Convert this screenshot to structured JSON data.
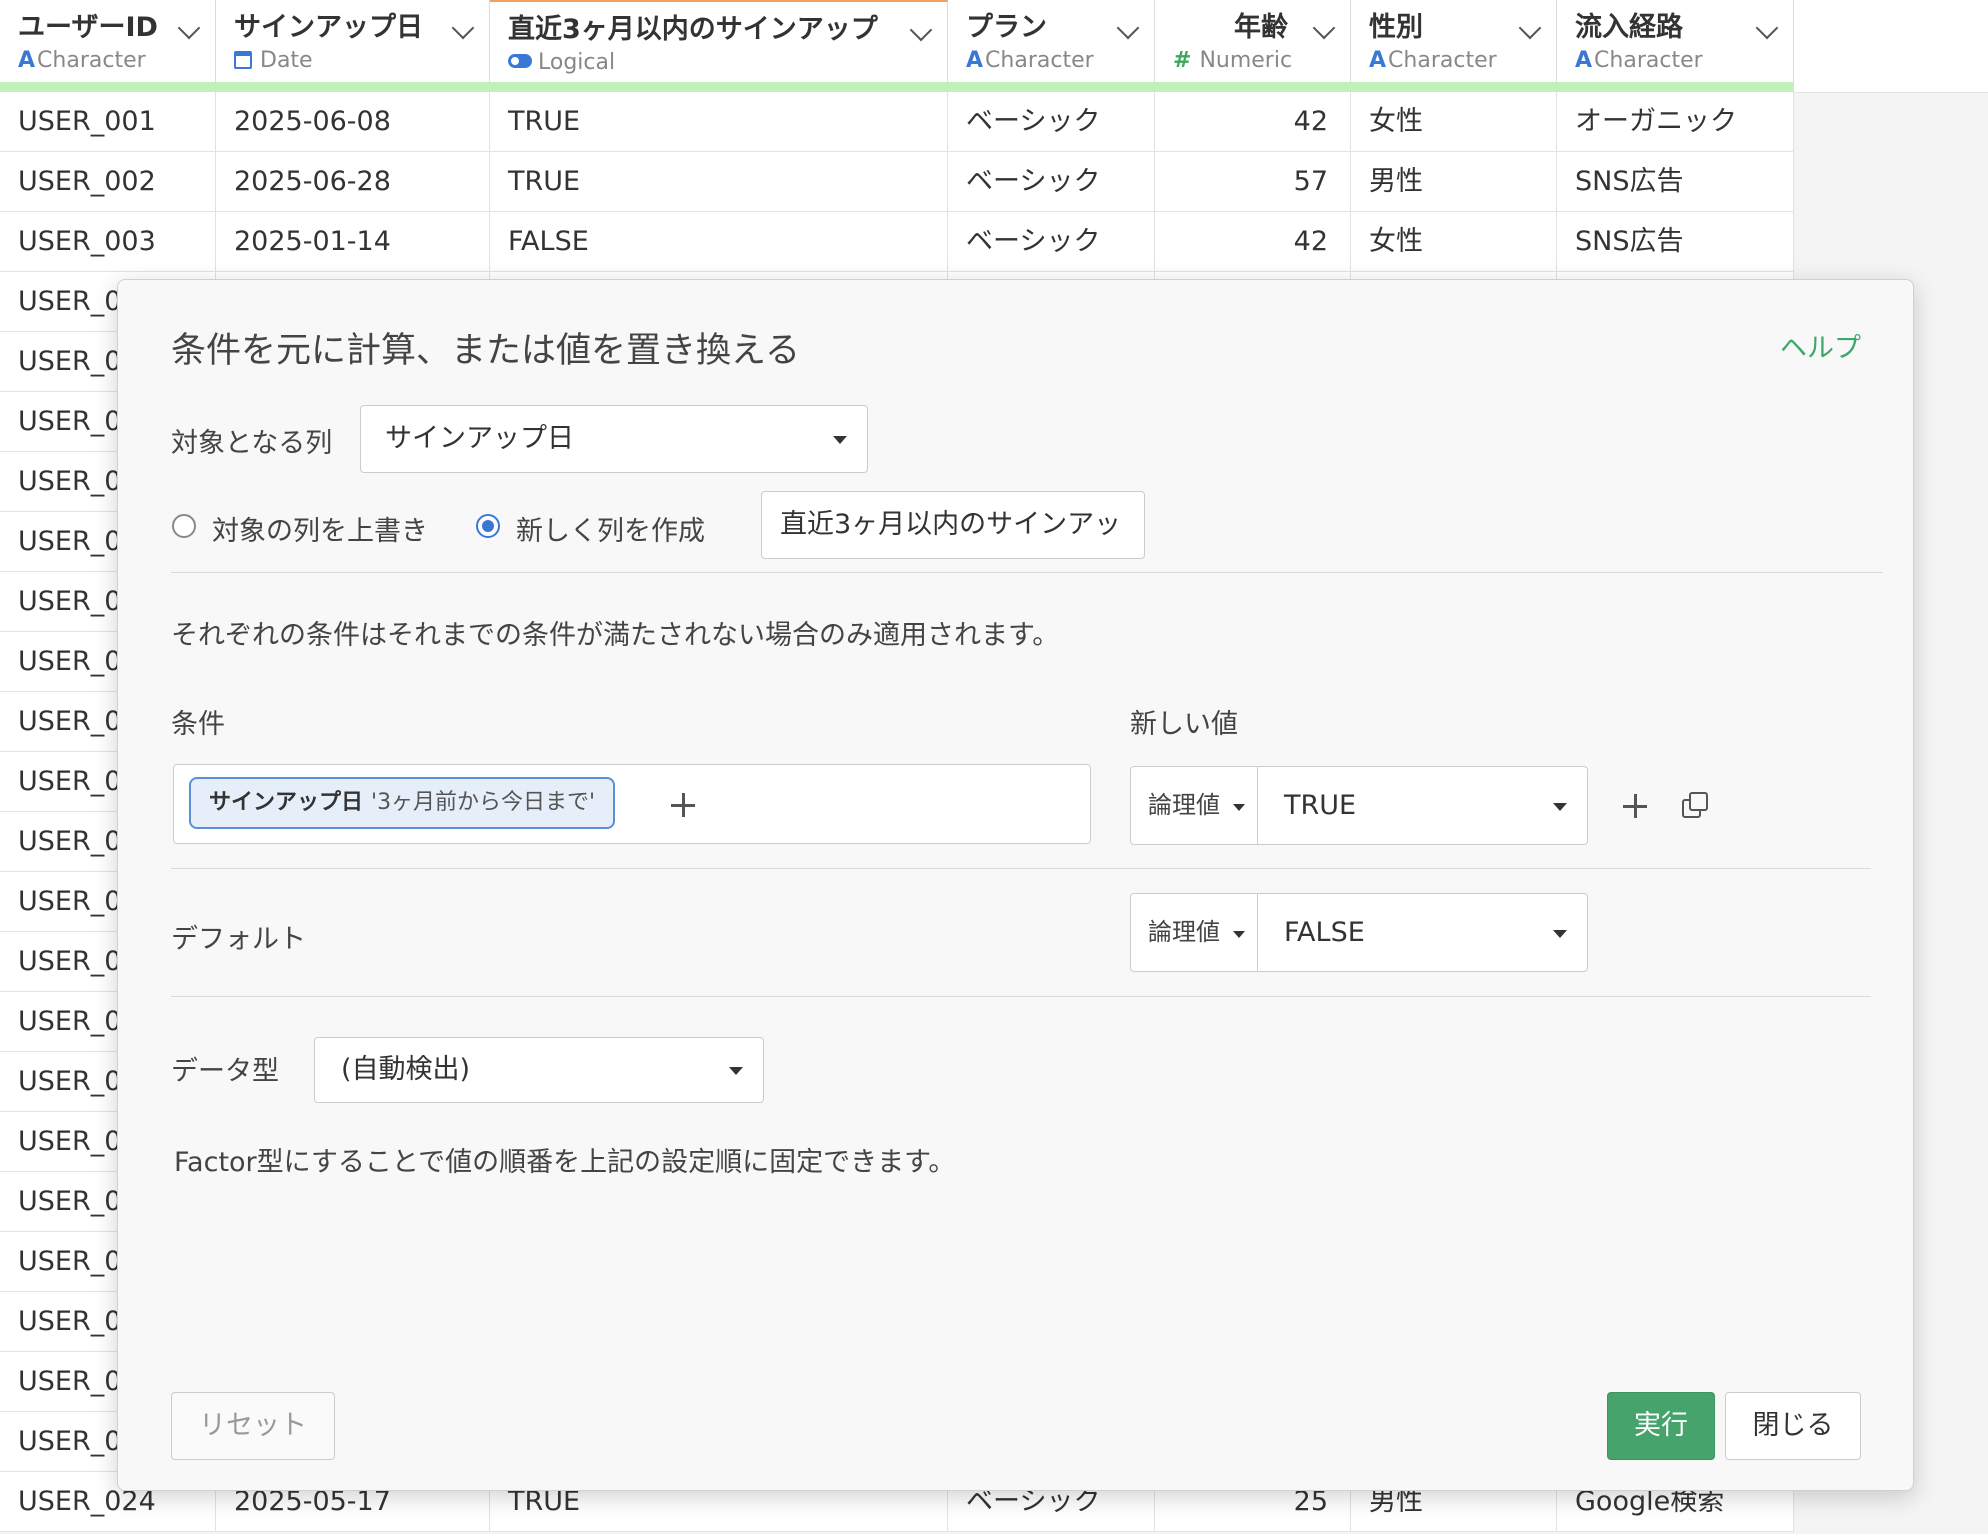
{
  "columns": [
    {
      "name": "ユーザーID",
      "type": "Character",
      "type_icon": "character-icon"
    },
    {
      "name": "サインアップ日",
      "type": "Date",
      "type_icon": "calendar-icon"
    },
    {
      "name": "直近3ヶ月以内のサインアップ",
      "type": "Logical",
      "type_icon": "toggle-icon"
    },
    {
      "name": "プラン",
      "type": "Character",
      "type_icon": "character-icon"
    },
    {
      "name": "年齢",
      "type": "Numeric",
      "type_icon": "hash-icon"
    },
    {
      "name": "性別",
      "type": "Character",
      "type_icon": "character-icon"
    },
    {
      "name": "流入経路",
      "type": "Character",
      "type_icon": "character-icon"
    }
  ],
  "rows": [
    [
      "USER_001",
      "2025-06-08",
      "TRUE",
      "ベーシック",
      "42",
      "女性",
      "オーガニック"
    ],
    [
      "USER_002",
      "2025-06-28",
      "TRUE",
      "ベーシック",
      "57",
      "男性",
      "SNS広告"
    ],
    [
      "USER_003",
      "2025-01-14",
      "FALSE",
      "ベーシック",
      "42",
      "女性",
      "SNS広告"
    ],
    [
      "USER_0"
    ],
    [
      "USER_0"
    ],
    [
      "USER_0"
    ],
    [
      "USER_0"
    ],
    [
      "USER_0"
    ],
    [
      "USER_0"
    ],
    [
      "USER_0"
    ],
    [
      "USER_0"
    ],
    [
      "USER_0"
    ],
    [
      "USER_0"
    ],
    [
      "USER_0"
    ],
    [
      "USER_0"
    ],
    [
      "USER_0"
    ],
    [
      "USER_0"
    ],
    [
      "USER_0"
    ],
    [
      "USER_0"
    ],
    [
      "USER_0"
    ],
    [
      "USER_0"
    ],
    [
      "USER_0"
    ],
    [
      "USER_0"
    ],
    [
      "USER_024",
      "2025-05-17",
      "TRUE",
      "ベーシック",
      "25",
      "男性",
      "Google検索"
    ]
  ],
  "dialog": {
    "title": "条件を元に計算、または値を置き換える",
    "help_label": "ヘルプ",
    "target_column_label": "対象となる列",
    "target_column_value": "サインアップ日",
    "radio_overwrite_label": "対象の列を上書き",
    "radio_new_label": "新しく列を作成",
    "new_column_name": "直近3ヶ月以内のサインアッ",
    "description": "それぞれの条件はそれまでの条件が満たされない場合のみ適用されます。",
    "condition_header": "条件",
    "new_value_header": "新しい値",
    "condition_chip_column": "サインアップ日",
    "condition_chip_value": "'3ヶ月前から今日まで'",
    "condition_value_type": "論理値",
    "condition_value": "TRUE",
    "default_label": "デフォルト",
    "default_value_type": "論理値",
    "default_value": "FALSE",
    "data_type_label": "データ型",
    "data_type_value": "(自動検出)",
    "factor_note": "Factor型にすることで値の順番を上記の設定順に固定できます。",
    "reset_label": "リセット",
    "run_label": "実行",
    "close_label": "閉じる"
  },
  "colors": {
    "accent_green": "#45a36b",
    "link_green": "#3ea86a",
    "radio_blue": "#3a78d6",
    "header_bar": "#c3efbd"
  }
}
